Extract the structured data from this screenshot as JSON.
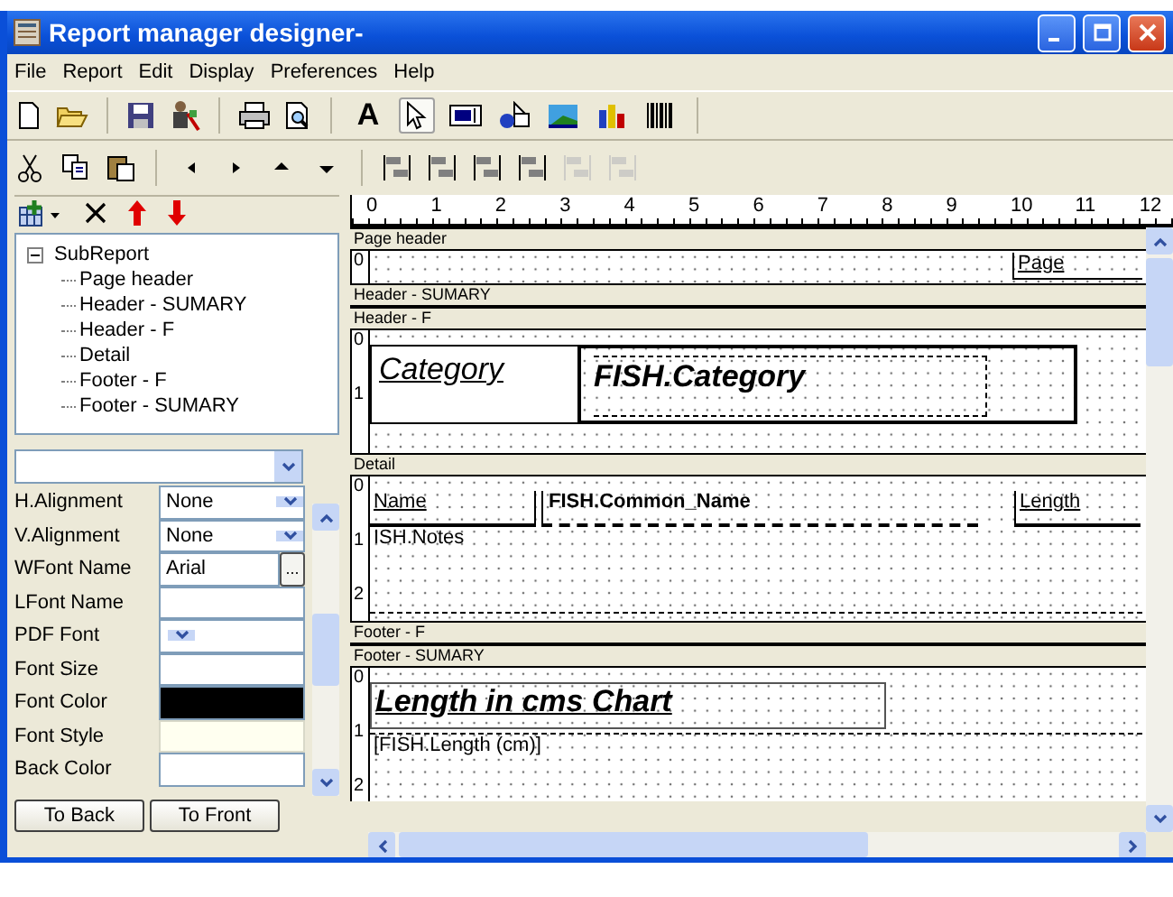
{
  "window": {
    "title": "Report manager designer-"
  },
  "menu": [
    "File",
    "Report",
    "Edit",
    "Display",
    "Preferences",
    "Help"
  ],
  "file_tools": [
    {
      "kind": "new"
    },
    {
      "kind": "open"
    },
    {
      "kind": "save"
    },
    {
      "kind": "wizard"
    },
    {
      "kind": "print"
    },
    {
      "kind": "preview"
    }
  ],
  "insert_tools": [
    {
      "kind": "label",
      "glyph": "A",
      "selected": false
    },
    {
      "kind": "pointer",
      "selected": true
    },
    {
      "kind": "edit",
      "selected": false
    },
    {
      "kind": "shape",
      "selected": false
    },
    {
      "kind": "image",
      "selected": false
    },
    {
      "kind": "chart",
      "selected": false
    },
    {
      "kind": "barcode",
      "selected": false
    }
  ],
  "edit_tools": [
    {
      "kind": "cut",
      "disabled": false
    },
    {
      "kind": "copy",
      "disabled": false
    },
    {
      "kind": "paste",
      "disabled": false
    },
    {
      "kind": "left",
      "disabled": false
    },
    {
      "kind": "right",
      "disabled": false
    },
    {
      "kind": "up",
      "disabled": false
    },
    {
      "kind": "down",
      "disabled": false
    },
    {
      "kind": "align-left",
      "disabled": false
    },
    {
      "kind": "align-right",
      "disabled": false
    },
    {
      "kind": "align-top",
      "disabled": false
    },
    {
      "kind": "align-bottom",
      "disabled": false
    },
    {
      "kind": "align-hcenter",
      "disabled": true
    },
    {
      "kind": "align-vcenter",
      "disabled": true
    }
  ],
  "section_tools": [
    {
      "kind": "add"
    },
    {
      "kind": "delete"
    },
    {
      "kind": "move-up"
    },
    {
      "kind": "move-down"
    }
  ],
  "tree": {
    "label": "SubReport",
    "expanded": true,
    "children": [
      {
        "label": "Page header"
      },
      {
        "label": "Header - SUMARY"
      },
      {
        "label": "Header - F"
      },
      {
        "label": "Detail"
      },
      {
        "label": "Footer - F"
      },
      {
        "label": "Footer - SUMARY"
      }
    ]
  },
  "properties": [
    {
      "name": "H.Alignment",
      "kind": "dropdown",
      "value": "None",
      "selected": false
    },
    {
      "name": "V.Alignment",
      "kind": "dropdown",
      "value": "None",
      "selected": false
    },
    {
      "name": "WFont Name",
      "kind": "browse",
      "value": "Arial",
      "browse_label": "...",
      "selected": false
    },
    {
      "name": "LFont Name",
      "kind": "text",
      "selected": false
    },
    {
      "name": "PDF Font",
      "kind": "dropdown",
      "selected": false
    },
    {
      "name": "Font Size",
      "kind": "text",
      "selected": false
    },
    {
      "name": "Font Color",
      "kind": "color",
      "color": "#000000",
      "selected": false
    },
    {
      "name": "Font Style",
      "kind": "text",
      "selected": true
    },
    {
      "name": "Back Color",
      "kind": "color",
      "color": "#ffffff",
      "selected": false
    }
  ],
  "buttons": [
    "To Back",
    "To Front"
  ],
  "ruler": [
    "0",
    "1",
    "2",
    "3",
    "4",
    "5",
    "6",
    "7",
    "8",
    "9",
    "10",
    "11",
    "12"
  ],
  "sections": [
    {
      "label": "Page header",
      "ruler": [
        "0"
      ],
      "items": [
        {
          "kind": "label",
          "text": "Page"
        }
      ]
    },
    {
      "label": "Header - SUMARY"
    },
    {
      "label": "Header - F",
      "ruler": [
        "0",
        "1"
      ],
      "items": [
        {
          "kind": "label",
          "text": "Category"
        },
        {
          "kind": "field",
          "text": "FISH.Category"
        },
        {
          "kind": "rectangle"
        }
      ]
    },
    {
      "label": "Detail",
      "ruler": [
        "0",
        "1",
        "2"
      ],
      "items": [
        {
          "kind": "label",
          "text": "Name"
        },
        {
          "kind": "field",
          "text": "FISH.Common_Name"
        },
        {
          "kind": "label",
          "text": "Length"
        },
        {
          "kind": "field",
          "text": "ISH.Notes"
        }
      ]
    },
    {
      "label": "Footer - F"
    },
    {
      "label": "Footer - SUMARY",
      "ruler": [
        "0",
        "1",
        "2"
      ],
      "items": [
        {
          "kind": "label",
          "text": "Length in cms Chart"
        },
        {
          "kind": "chart",
          "text": "[FISH.Length (cm)]"
        }
      ]
    }
  ]
}
